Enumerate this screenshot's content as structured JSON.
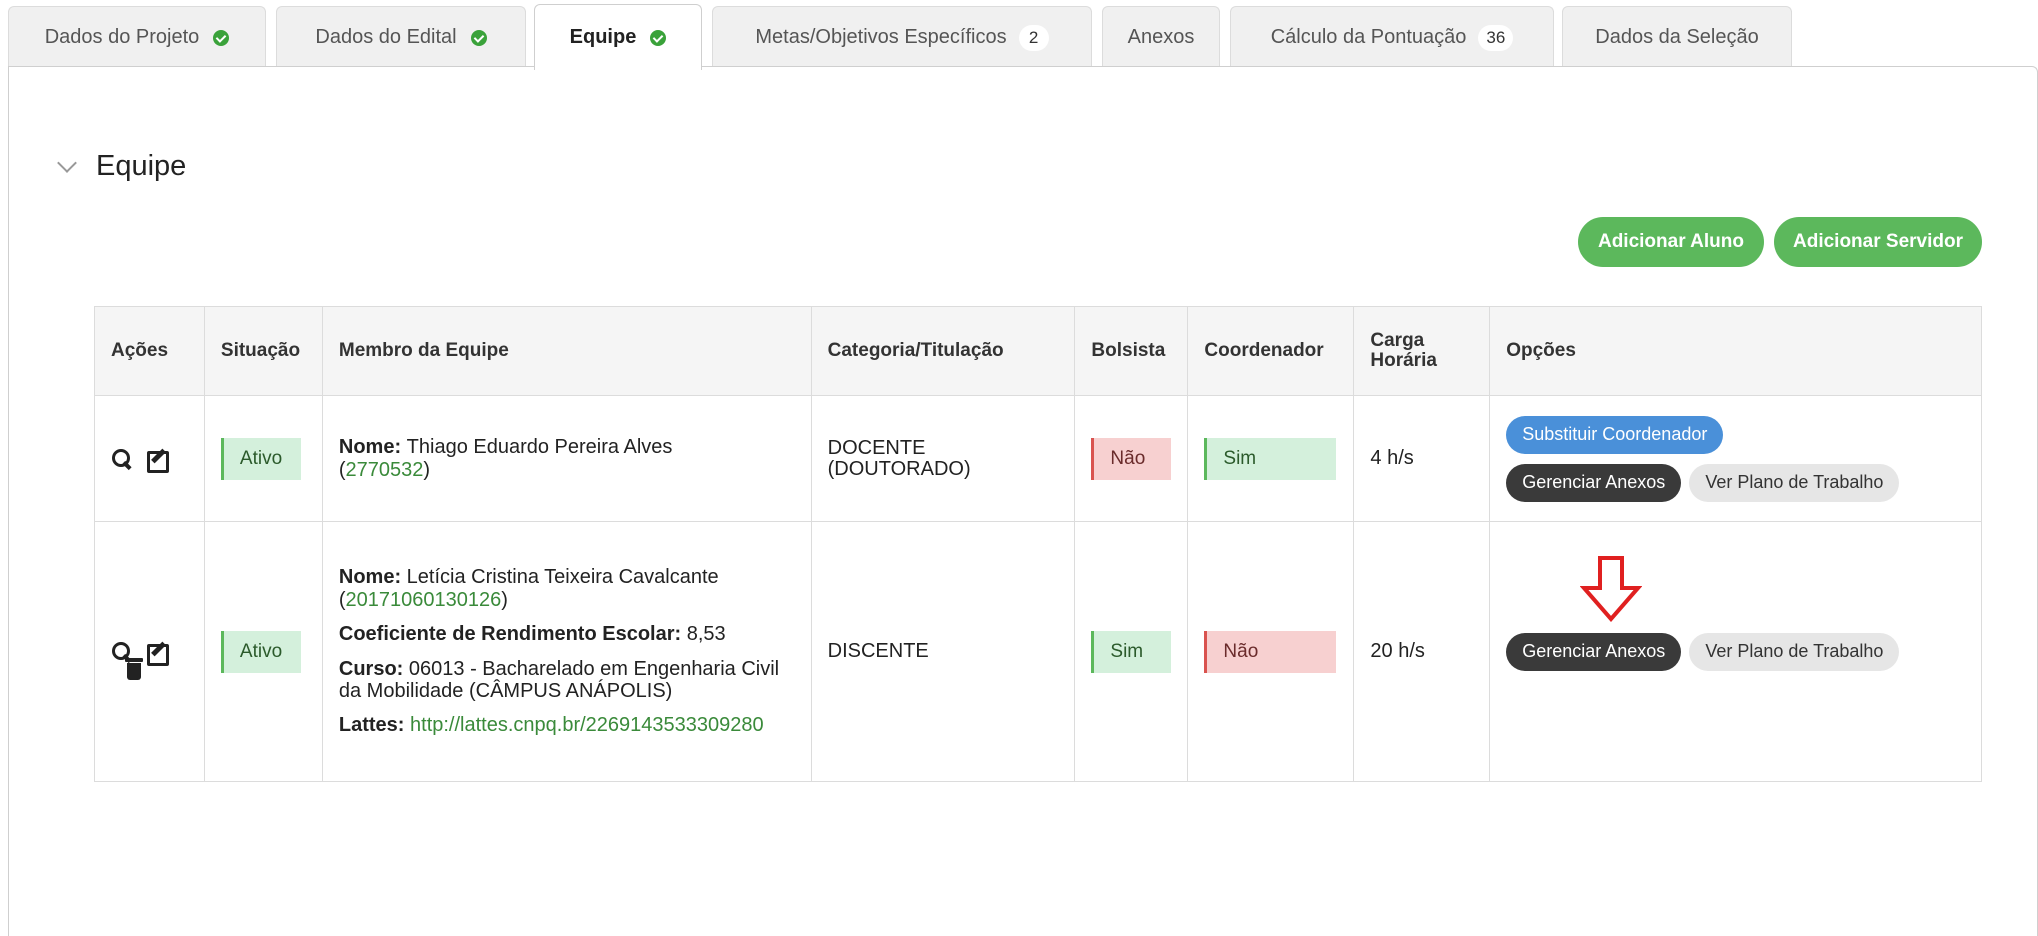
{
  "tabs": [
    {
      "label": "Dados do Projeto",
      "ok": true
    },
    {
      "label": "Dados do Edital",
      "ok": true
    },
    {
      "label": "Equipe",
      "ok": true,
      "active": true
    },
    {
      "label": "Metas/Objetivos Específicos",
      "count": "2"
    },
    {
      "label": "Anexos"
    },
    {
      "label": "Cálculo da Pontuação",
      "count": "36"
    },
    {
      "label": "Dados da Seleção"
    }
  ],
  "section": {
    "title": "Equipe"
  },
  "buttons": {
    "add_student": "Adicionar Aluno",
    "add_server": "Adicionar Servidor"
  },
  "table": {
    "headers": [
      "Ações",
      "Situação",
      "Membro da Equipe",
      "Categoria/Titulação",
      "Bolsista",
      "Coordenador",
      "Carga Horária",
      "Opções"
    ],
    "rows": [
      {
        "status": "Ativo",
        "name_label": "Nome:",
        "name": "Thiago Eduardo Pereira Alves",
        "id": "2770532",
        "category": "DOCENTE (DOUTORADO)",
        "bolsista": "Não",
        "coordenador": "Sim",
        "carga": "4 h/s",
        "opt_replace": "Substituir Coordenador",
        "opt_manage": "Gerenciar Anexos",
        "opt_plan": "Ver Plano de Trabalho"
      },
      {
        "status": "Ativo",
        "name_label": "Nome:",
        "name": "Letícia Cristina Teixeira Cavalcante",
        "id": "20171060130126",
        "coef_label": "Coeficiente de Rendimento Escolar:",
        "coef": "8,53",
        "curso_label": "Curso:",
        "curso": "06013 - Bacharelado em Engenharia Civil da Mobilidade (CÂMPUS ANÁPOLIS)",
        "lattes_label": "Lattes:",
        "lattes": "http://lattes.cnpq.br/2269143533309280",
        "category": "DISCENTE",
        "bolsista": "Sim",
        "coordenador": "Não",
        "carga": "20 h/s",
        "opt_manage": "Gerenciar Anexos",
        "opt_plan": "Ver Plano de Trabalho"
      }
    ]
  },
  "colors": {
    "green": "#5cb85c",
    "red": "#d9534f",
    "blue": "#4a90d9",
    "arrow": "#e02020"
  },
  "icons": [
    "check-circle-icon",
    "chevron-down-icon",
    "search-icon",
    "edit-icon",
    "trash-icon",
    "down-arrow-icon"
  ]
}
